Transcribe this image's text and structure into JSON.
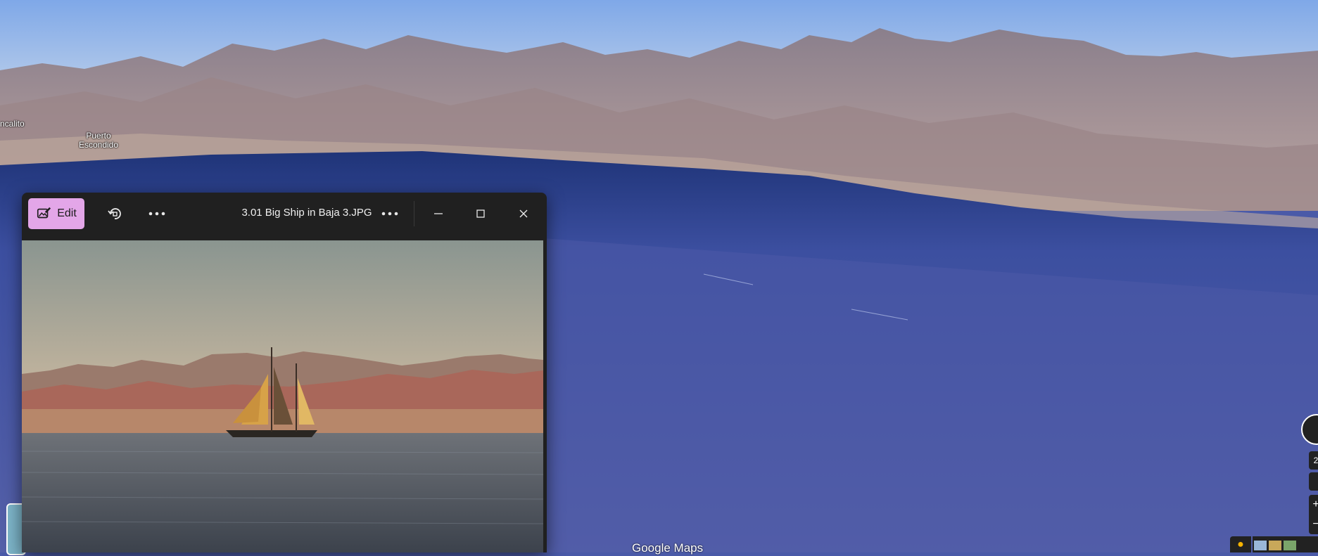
{
  "map": {
    "place_labels": [
      {
        "id": "rincon",
        "text": "ncalito"
      },
      {
        "id": "puerto",
        "text": "Puerto Escondido"
      }
    ],
    "logo": "Google Maps",
    "controls": {
      "tilt_label": "2"
    }
  },
  "photo_viewer": {
    "edit_label": "Edit",
    "title": "3.01 Big Ship in Baja 3.JPG",
    "icons": [
      "edit-photo-icon",
      "rotate-icon",
      "more-icon",
      "minimize-icon",
      "maximize-icon",
      "close-icon"
    ]
  },
  "colors": {
    "edit_accent": "#e3a6e8",
    "titlebar_bg": "#202020",
    "sea": "#4a5aa8"
  }
}
